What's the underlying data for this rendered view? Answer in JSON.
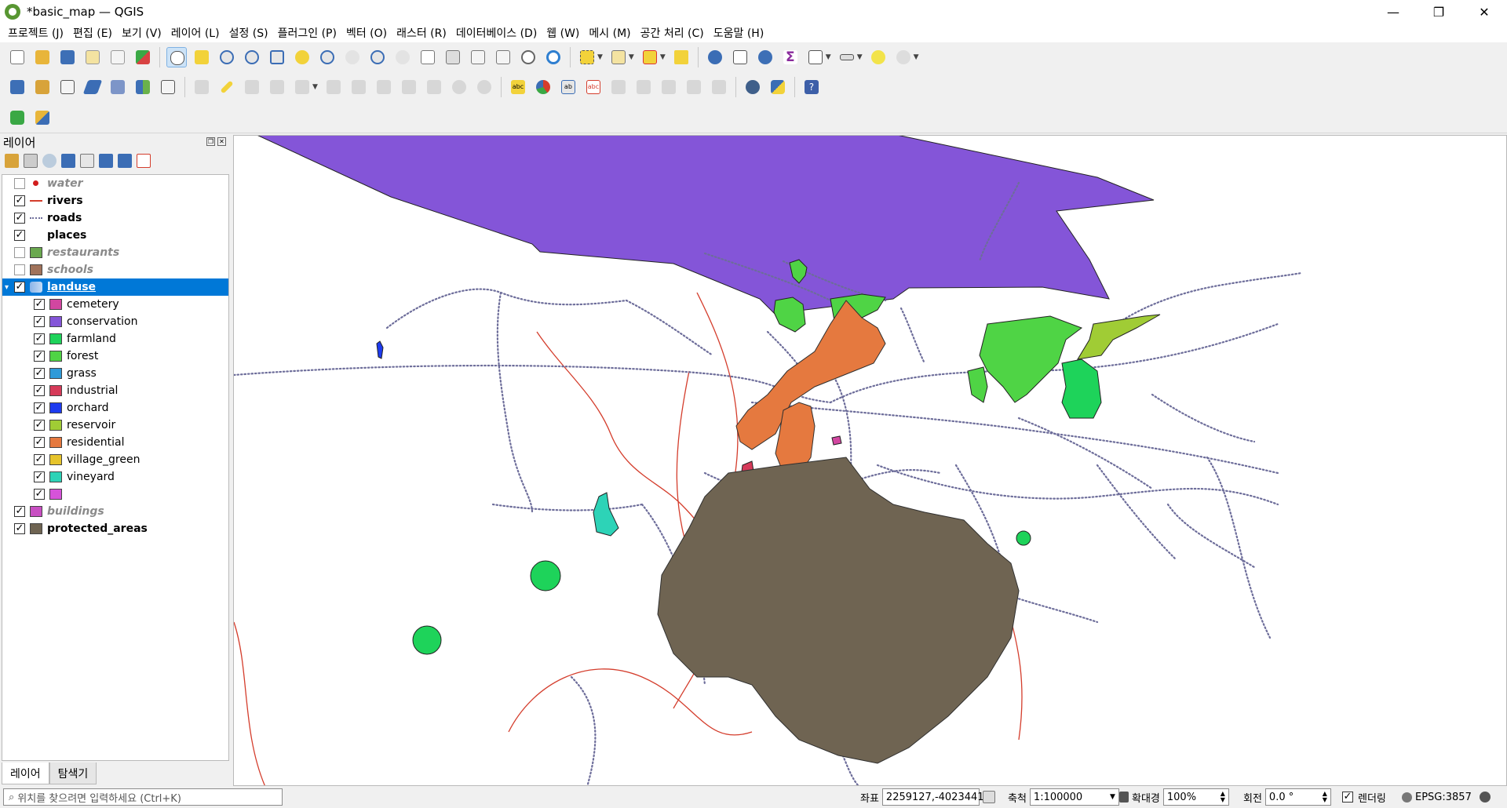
{
  "window": {
    "title": "*basic_map — QGIS",
    "minimize": "—",
    "restore": "❐",
    "close": "✕"
  },
  "menu": [
    "프로젝트 (J)",
    "편집 (E)",
    "보기 (V)",
    "레이어 (L)",
    "설정 (S)",
    "플러그인 (P)",
    "벡터 (O)",
    "래스터 (R)",
    "데이터베이스 (D)",
    "웹 (W)",
    "메시 (M)",
    "공간 처리 (C)",
    "도움말 (H)"
  ],
  "layers_panel": {
    "title": "레이어",
    "tabs": [
      "레이어",
      "탐색기"
    ],
    "layers": [
      {
        "name": "water",
        "checked": false,
        "style": "ital",
        "symbol": "dot"
      },
      {
        "name": "rivers",
        "checked": true,
        "style": "bold",
        "symbol": "line"
      },
      {
        "name": "roads",
        "checked": true,
        "style": "bold",
        "symbol": "dotline"
      },
      {
        "name": "places",
        "checked": true,
        "style": "bold",
        "symbol": "none"
      },
      {
        "name": "restaurants",
        "checked": false,
        "style": "ital",
        "symbol": "fill",
        "color": "#6aa84f"
      },
      {
        "name": "schools",
        "checked": false,
        "style": "ital",
        "symbol": "fill",
        "color": "#a0725a"
      },
      {
        "name": "landuse",
        "checked": true,
        "style": "link",
        "symbol": "poly",
        "selected": true,
        "expanded": true
      },
      {
        "name": "buildings",
        "checked": true,
        "style": "ital",
        "symbol": "fill",
        "color": "#c84fc2"
      },
      {
        "name": "protected_areas",
        "checked": true,
        "style": "bold",
        "symbol": "fill",
        "color": "#6f6452"
      }
    ],
    "landuse_classes": [
      {
        "name": "cemetery",
        "color": "#d246a0"
      },
      {
        "name": "conservation",
        "color": "#8455d8"
      },
      {
        "name": "farmland",
        "color": "#1ed35a"
      },
      {
        "name": "forest",
        "color": "#4fd445"
      },
      {
        "name": "grass",
        "color": "#2f9ad8"
      },
      {
        "name": "industrial",
        "color": "#d63a59"
      },
      {
        "name": "orchard",
        "color": "#1d3bef"
      },
      {
        "name": "reservoir",
        "color": "#a0cc35"
      },
      {
        "name": "residential",
        "color": "#e5793f"
      },
      {
        "name": "village_green",
        "color": "#e6c42c"
      },
      {
        "name": "vineyard",
        "color": "#2dd3b7"
      },
      {
        "name": "",
        "color": "#d653d9"
      }
    ]
  },
  "status": {
    "locator_placeholder": "위치를 찾으려면 입력하세요 (Ctrl+K)",
    "coord_label": "좌표",
    "coord_value": "2259127,-4023441",
    "scale_label": "축척",
    "scale_value": "1:100000",
    "magnifier_label": "확대경",
    "magnifier_value": "100%",
    "rotation_label": "회전",
    "rotation_value": "0.0 °",
    "render_label": "렌더링",
    "crs": "EPSG:3857"
  },
  "colors": {
    "conservation": "#8455d8",
    "residential": "#e5793f",
    "protected": "#6f6452",
    "forest": "#4fd445",
    "farmland": "#1ed35a",
    "reservoir": "#a0cc35",
    "vineyard": "#2dd3b7",
    "industrial": "#d63a59",
    "cemetery": "#d246a0",
    "orchard": "#1d3bef",
    "roads": "#6d6d9a",
    "rivers": "#d43d2c",
    "selection": "#0078d7"
  }
}
